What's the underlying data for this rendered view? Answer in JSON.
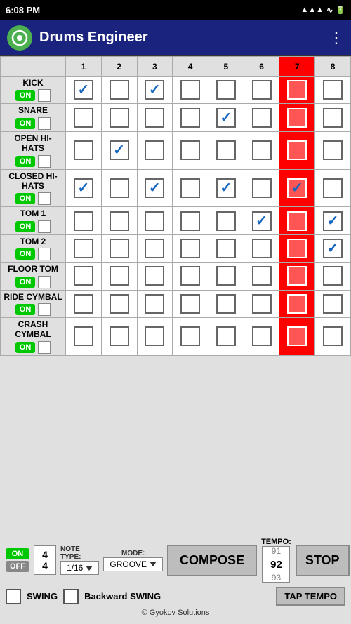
{
  "statusBar": {
    "time": "6:08 PM",
    "icons": "signal wifi battery"
  },
  "appBar": {
    "title": "Drums Engineer",
    "menuIcon": "⋮"
  },
  "drumRows": [
    {
      "name": "KICK",
      "on": true,
      "beats": [
        {
          "num": 1,
          "checked": true,
          "red": false
        },
        {
          "num": 2,
          "checked": false,
          "red": false
        },
        {
          "num": 3,
          "checked": true,
          "red": false
        },
        {
          "num": 4,
          "checked": false,
          "red": false
        },
        {
          "num": 5,
          "checked": false,
          "red": false
        },
        {
          "num": 6,
          "checked": false,
          "red": false
        },
        {
          "num": 7,
          "checked": false,
          "red": true
        },
        {
          "num": 8,
          "checked": false,
          "red": false
        }
      ]
    },
    {
      "name": "SNARE",
      "on": true,
      "beats": [
        {
          "num": 1,
          "checked": false,
          "red": false
        },
        {
          "num": 2,
          "checked": false,
          "red": false
        },
        {
          "num": 3,
          "checked": false,
          "red": false
        },
        {
          "num": 4,
          "checked": false,
          "red": false
        },
        {
          "num": 5,
          "checked": true,
          "red": false
        },
        {
          "num": 6,
          "checked": false,
          "red": false
        },
        {
          "num": 7,
          "checked": false,
          "red": true
        },
        {
          "num": 8,
          "checked": false,
          "red": false
        }
      ]
    },
    {
      "name": "OPEN HI-HATS",
      "on": true,
      "beats": [
        {
          "num": 1,
          "checked": false,
          "red": false
        },
        {
          "num": 2,
          "checked": true,
          "red": false
        },
        {
          "num": 3,
          "checked": false,
          "red": false
        },
        {
          "num": 4,
          "checked": false,
          "red": false
        },
        {
          "num": 5,
          "checked": false,
          "red": false
        },
        {
          "num": 6,
          "checked": false,
          "red": false
        },
        {
          "num": 7,
          "checked": false,
          "red": true
        },
        {
          "num": 8,
          "checked": false,
          "red": false
        }
      ]
    },
    {
      "name": "CLOSED HI-HATS",
      "on": true,
      "beats": [
        {
          "num": 1,
          "checked": true,
          "red": false
        },
        {
          "num": 2,
          "checked": false,
          "red": false
        },
        {
          "num": 3,
          "checked": true,
          "red": false
        },
        {
          "num": 4,
          "checked": false,
          "red": false
        },
        {
          "num": 5,
          "checked": true,
          "red": false
        },
        {
          "num": 6,
          "checked": false,
          "red": false
        },
        {
          "num": 7,
          "checked": true,
          "red": true
        },
        {
          "num": 8,
          "checked": false,
          "red": false
        }
      ]
    },
    {
      "name": "TOM 1",
      "on": true,
      "beats": [
        {
          "num": 1,
          "checked": false,
          "red": false
        },
        {
          "num": 2,
          "checked": false,
          "red": false
        },
        {
          "num": 3,
          "checked": false,
          "red": false
        },
        {
          "num": 4,
          "checked": false,
          "red": false
        },
        {
          "num": 5,
          "checked": false,
          "red": false
        },
        {
          "num": 6,
          "checked": true,
          "red": false
        },
        {
          "num": 7,
          "checked": false,
          "red": true
        },
        {
          "num": 8,
          "checked": true,
          "red": false
        }
      ]
    },
    {
      "name": "TOM 2",
      "on": true,
      "beats": [
        {
          "num": 1,
          "checked": false,
          "red": false
        },
        {
          "num": 2,
          "checked": false,
          "red": false
        },
        {
          "num": 3,
          "checked": false,
          "red": false
        },
        {
          "num": 4,
          "checked": false,
          "red": false
        },
        {
          "num": 5,
          "checked": false,
          "red": false
        },
        {
          "num": 6,
          "checked": false,
          "red": false
        },
        {
          "num": 7,
          "checked": false,
          "red": true
        },
        {
          "num": 8,
          "checked": true,
          "red": false
        }
      ]
    },
    {
      "name": "FLOOR TOM",
      "on": true,
      "beats": [
        {
          "num": 1,
          "checked": false,
          "red": false
        },
        {
          "num": 2,
          "checked": false,
          "red": false
        },
        {
          "num": 3,
          "checked": false,
          "red": false
        },
        {
          "num": 4,
          "checked": false,
          "red": false
        },
        {
          "num": 5,
          "checked": false,
          "red": false
        },
        {
          "num": 6,
          "checked": false,
          "red": false
        },
        {
          "num": 7,
          "checked": false,
          "red": true
        },
        {
          "num": 8,
          "checked": false,
          "red": false
        }
      ]
    },
    {
      "name": "RIDE CYMBAL",
      "on": true,
      "beats": [
        {
          "num": 1,
          "checked": false,
          "red": false
        },
        {
          "num": 2,
          "checked": false,
          "red": false
        },
        {
          "num": 3,
          "checked": false,
          "red": false
        },
        {
          "num": 4,
          "checked": false,
          "red": false
        },
        {
          "num": 5,
          "checked": false,
          "red": false
        },
        {
          "num": 6,
          "checked": false,
          "red": false
        },
        {
          "num": 7,
          "checked": false,
          "red": true
        },
        {
          "num": 8,
          "checked": false,
          "red": false
        }
      ]
    },
    {
      "name": "CRASH CYMBAL",
      "on": true,
      "beats": [
        {
          "num": 1,
          "checked": false,
          "red": false
        },
        {
          "num": 2,
          "checked": false,
          "red": false
        },
        {
          "num": 3,
          "checked": false,
          "red": false
        },
        {
          "num": 4,
          "checked": false,
          "red": false
        },
        {
          "num": 5,
          "checked": false,
          "red": false
        },
        {
          "num": 6,
          "checked": false,
          "red": false
        },
        {
          "num": 7,
          "checked": false,
          "red": true
        },
        {
          "num": 8,
          "checked": false,
          "red": false
        }
      ]
    }
  ],
  "bottomControls": {
    "onLabel": "ON",
    "offLabel": "OFF",
    "timeSigTop": "4",
    "timeSigBot": "4",
    "noteTypeLabel": "NOTE TYPE:",
    "noteTypeValue": "1/16",
    "modeLabel": "MODE:",
    "modeValue": "GROOVE",
    "composeLabel": "COMPOSE",
    "tempoLabel": "TEMPO:",
    "tempoValues": [
      "91",
      "92",
      "93"
    ],
    "tempoActive": 1,
    "stopLabel": "STOP",
    "swingLabel": "SWING",
    "backwardSwingLabel": "Backward SWING",
    "tapTempoLabel": "TAP TEMPO",
    "copyright": "© Gyokov Solutions"
  }
}
